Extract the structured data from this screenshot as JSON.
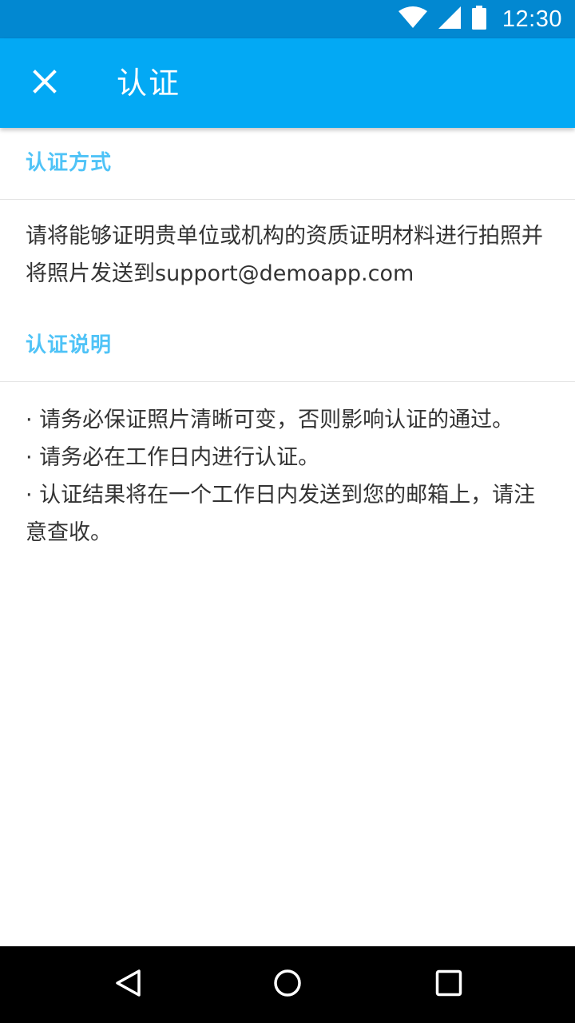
{
  "status_bar": {
    "time": "12:30",
    "icons": [
      "wifi-icon",
      "cellular-signal-icon",
      "battery-icon"
    ]
  },
  "app_bar": {
    "title": "认证",
    "close_icon": "close-icon"
  },
  "sections": [
    {
      "header": "认证方式",
      "body": [
        "请将能够证明贵单位或机构的资质证明材料进行拍照并将照片发送到support@demoapp.com"
      ]
    },
    {
      "header": "认证说明",
      "body": [
        "· 请务必保证照片清晰可变，否则影响认证的通过。",
        "· 请务必在工作日内进行认证。",
        "· 认证结果将在一个工作日内发送到您的邮箱上，请注意查收。"
      ]
    }
  ],
  "nav_bar": {
    "buttons": [
      "back-icon",
      "home-icon",
      "recents-icon"
    ]
  },
  "colors": {
    "status_bar": "#0288d1",
    "app_bar": "#03a9f4",
    "section_header": "#4fc3f7",
    "body_text": "#333333",
    "nav_bar": "#000000"
  }
}
